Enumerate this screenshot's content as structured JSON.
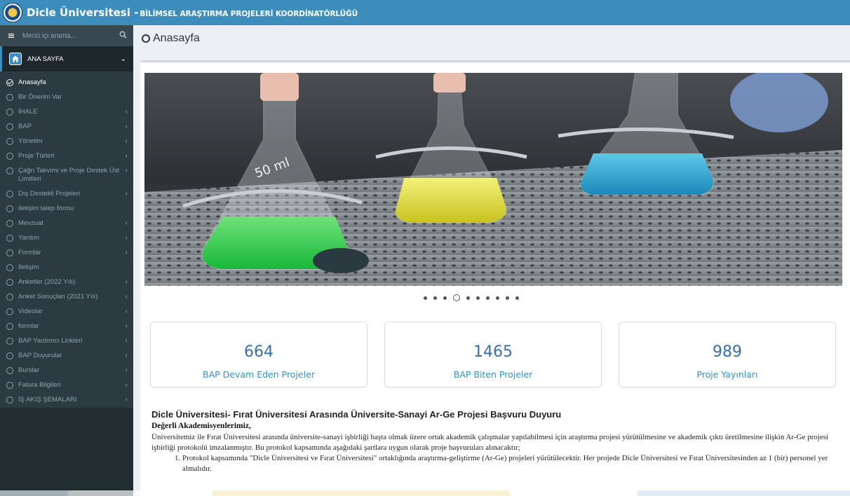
{
  "header": {
    "brand_main": "Dicle Üniversitesi -",
    "brand_sub": "BİLİMSEL ARAŞTIRMA PROJELERİ KOORDİNATÖRLÜĞÜ",
    "color": "#3c8dbc"
  },
  "sidebar": {
    "search_placeholder": "Menü içi arama...",
    "section_label": "ANA SAYFA",
    "items": [
      {
        "label": "Anasayfa",
        "has_submenu": false,
        "active": true
      },
      {
        "label": "Bir Önerim Var",
        "has_submenu": false
      },
      {
        "label": "İHALE",
        "has_submenu": true
      },
      {
        "label": "BAP",
        "has_submenu": true
      },
      {
        "label": "Yönetim",
        "has_submenu": true
      },
      {
        "label": "Proje Türleri",
        "has_submenu": true
      },
      {
        "label": "Çağrı Takvimi ve Proje Destek Üst Limitleri",
        "has_submenu": true
      },
      {
        "label": "Dış Destekli Projeleri",
        "has_submenu": true
      },
      {
        "label": "iletişim talep formu",
        "has_submenu": false
      },
      {
        "label": "Mevzuat",
        "has_submenu": true
      },
      {
        "label": "Yardım",
        "has_submenu": true
      },
      {
        "label": "Formlar",
        "has_submenu": true
      },
      {
        "label": "İletişim",
        "has_submenu": false
      },
      {
        "label": "Anketler (2022 Yılı)",
        "has_submenu": true
      },
      {
        "label": "Anket Sonuçları (2021 Yılı)",
        "has_submenu": true
      },
      {
        "label": "Videolar",
        "has_submenu": true
      },
      {
        "label": "formlar",
        "has_submenu": true
      },
      {
        "label": "BAP Yardımcı Linkleri",
        "has_submenu": true
      },
      {
        "label": "BAP Duyurular",
        "has_submenu": true
      },
      {
        "label": "Burslar",
        "has_submenu": true
      },
      {
        "label": "Fatura Bilgileri",
        "has_submenu": true
      },
      {
        "label": "İŞ AKIŞ ŞEMALARI",
        "has_submenu": true
      }
    ]
  },
  "main": {
    "page_title": "Anasayfa",
    "carousel": {
      "slide_count": 10,
      "active_index": 3
    },
    "stats": [
      {
        "value": "664",
        "label": "BAP Devam Eden Projeler"
      },
      {
        "value": "1465",
        "label": "BAP Biten Projeler"
      },
      {
        "value": "989",
        "label": "Proje Yayınları"
      }
    ],
    "article": {
      "title": "Dicle Üniversitesi- Fırat Üniversitesi Arasında Üniversite-Sanayi Ar-Ge Projesi Başvuru Duyuru",
      "greeting": "Değerli Akademisyenlerimiz,",
      "paragraph": "Üniversitemiz ile Fırat Üniversitesi arasında üniversite-sanayi işbirliği başta olmak üzere ortak akademik çalışmalar yapılabilmesi için araştırma projesi yürütülmesine ve akademik çıktı üretilmesine ilişkin Ar-Ge projesi işbirliği protokolü imzalanmıştır. Bu protokol kapsamında aşağıdaki şartlara uygun olarak proje başvuruları alınacaktır;",
      "list": [
        "Protokol kapsamında \"Dicle Üniversitesi ve Fırat Üniversitesi\" ortaklığında araştırma-geliştirme (Ar-Ge) projeleri yürütülecektir. Her projede Dicle Üniversitesi ve Fırat Üniversitesinden az 1 (bir) personel yer almalıdır."
      ]
    }
  }
}
